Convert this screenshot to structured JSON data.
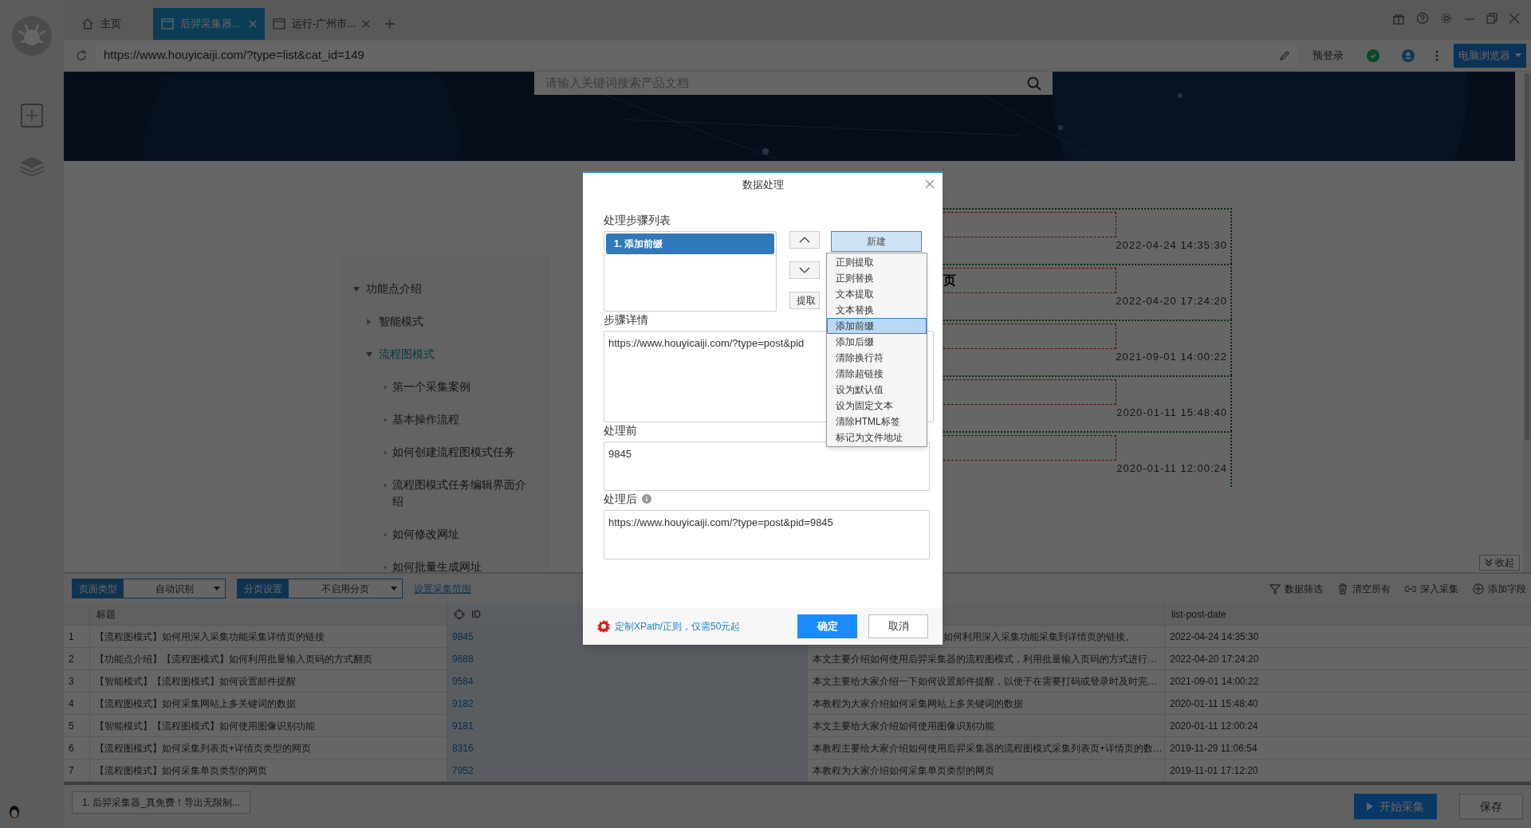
{
  "browser_tabs": [
    {
      "label": "主页",
      "selected": false,
      "kind": "home"
    },
    {
      "label": "后羿采集器...",
      "selected": true,
      "kind": "page"
    },
    {
      "label": "运行-广州市...",
      "selected": false,
      "kind": "page"
    }
  ],
  "address_bar": {
    "url": "https://www.houyicaiji.com/?type=list&cat_id=149",
    "pre_login": "预登录",
    "browser_mode": "电脑浏览器"
  },
  "page": {
    "search_placeholder": "请输入关键词搜索产品文档",
    "nav": [
      {
        "label": "功能点介绍",
        "selected": false,
        "expanded": true,
        "children": [
          {
            "label": "智能模式",
            "selected": false,
            "expanded": false
          },
          {
            "label": "流程图模式",
            "selected": true,
            "expanded": true,
            "children": [
              {
                "label": "第一个采集案例",
                "selected": false
              },
              {
                "label": "基本操作流程",
                "selected": false
              },
              {
                "label": "如何创建流程图模式任务",
                "selected": false
              },
              {
                "label": "流程图模式任务编辑界面介绍",
                "selected": false
              },
              {
                "label": "如何修改网址",
                "selected": false
              },
              {
                "label": "如何批量生成网址",
                "selected": false
              }
            ]
          }
        ]
      }
    ],
    "posts": [
      {
        "date": "2022-04-24 14:35:30"
      },
      {
        "heading": "页",
        "date": "2022-04-20 17:24:20"
      },
      {
        "date": "2021-09-01 14:00:22"
      },
      {
        "date": "2020-01-11 15:48:40"
      },
      {
        "date": "2020-01-11 12:00:24"
      }
    ],
    "collapse_button": "收起"
  },
  "bottom_panel": {
    "page_type": {
      "label": "页面类型",
      "value": "自动识别"
    },
    "pagination": {
      "label": "分页设置",
      "value": "不启用分页"
    },
    "range_link": "设置采集范围",
    "actions": [
      {
        "label": "数据筛选",
        "kind": "filter"
      },
      {
        "label": "清空所有",
        "kind": "trash"
      },
      {
        "label": "深入采集",
        "kind": "link"
      },
      {
        "label": "添加字段",
        "kind": "add"
      }
    ],
    "table": {
      "columns": [
        "标题",
        "ID",
        "list-post-date"
      ],
      "rows": [
        {
          "index": "1",
          "title": "【流程图模式】如何用深入采集功能采集详情页的链接",
          "id": "9845",
          "column_3": "如何利用深入采集功能采集到详情页的链接。",
          "date": "2022-04-24 14:35:30"
        },
        {
          "index": "2",
          "title": "【功能点介绍】【流程图模式】如何利用批量输入页码的方式翻页",
          "id": "9688",
          "column_3": "本文主要介绍如何使用后羿采集器的流程图模式，利用批量输入页码的方式进行…",
          "date": "2022-04-20 17:24:20"
        },
        {
          "index": "3",
          "title": "【智能模式】【流程图模式】如何设置邮件提醒",
          "id": "9584",
          "column_3": "本文主要给大家介绍一下如何设置邮件提醒，以便于在需要打码或登录时及时完…",
          "date": "2021-09-01 14:00:22"
        },
        {
          "index": "4",
          "title": "【流程图模式】如何采集网站上多关键词的数据",
          "id": "9182",
          "column_3": "本教程为大家介绍如何采集网站上多关键词的数据",
          "date": "2020-01-11 15:48:40"
        },
        {
          "index": "5",
          "title": "【智能模式】【流程图模式】如何使用图像识别功能",
          "id": "9181",
          "column_3": "本文主要给大家介绍如何使用图像识别功能",
          "date": "2020-01-11 12:00:24"
        },
        {
          "index": "6",
          "title": "【流程图模式】如何采集列表页+详情页类型的网页",
          "id": "8316",
          "column_3": "本教程主要给大家介绍如何使用后羿采集器的流程图模式采集列表页+详情页的数…",
          "date": "2019-11-29 11:06:54"
        },
        {
          "index": "7",
          "title": "【流程图模式】如何采集单页类型的网页",
          "id": "7952",
          "column_3": "本教程为大家介绍如何采集单页类型的网页",
          "date": "2019-11-01 17:12:20"
        }
      ]
    }
  },
  "status_bar": {
    "task_tab": "1. 后羿采集器_真免费！导出无限制...",
    "start_button": "开始采集",
    "save_button": "保存"
  },
  "dialog": {
    "title": "数据处理",
    "steps_label": "处理步骤列表",
    "steps": [
      {
        "label": "1. 添加前缀",
        "selected": true
      }
    ],
    "new_button": "新建",
    "extract_button": "提取",
    "menu": [
      {
        "label": "正则提取",
        "selected": false
      },
      {
        "label": "正则替换",
        "selected": false
      },
      {
        "label": "文本提取",
        "selected": false
      },
      {
        "label": "文本替换",
        "selected": false
      },
      {
        "label": "添加前缀",
        "selected": true
      },
      {
        "label": "添加后缀",
        "selected": false
      },
      {
        "label": "清除换行符",
        "selected": false
      },
      {
        "label": "清除超链接",
        "selected": false
      },
      {
        "label": "设为默认值",
        "selected": false
      },
      {
        "label": "设为固定文本",
        "selected": false
      },
      {
        "label": "清除HTML标签",
        "selected": false
      },
      {
        "label": "标记为文件地址",
        "selected": false
      }
    ],
    "detail_label": "步骤详情",
    "detail_value": "https://www.houyicaiji.com/?type=post&pid",
    "before_label": "处理前",
    "before_value": "9845",
    "after_label": "处理后",
    "after_value": "https://www.houyicaiji.com/?type=post&pid=9845",
    "promo_link": "定制XPath/正则，仅需50元起",
    "ok_button": "确定",
    "cancel_button": "取消"
  }
}
